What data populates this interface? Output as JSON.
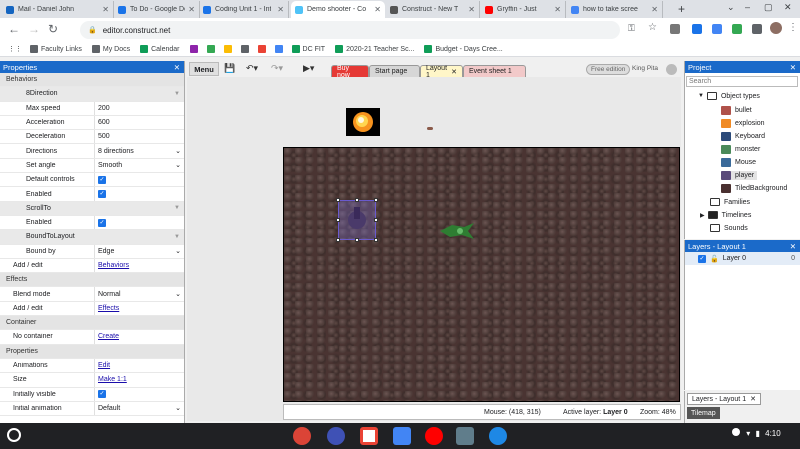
{
  "browser": {
    "tabs": [
      {
        "label": "Mail - Daniel John",
        "color": "#1565c0",
        "active": false
      },
      {
        "label": "To Do - Google Do",
        "color": "#1a73e8",
        "active": false
      },
      {
        "label": "Coding Unit 1 - Int",
        "color": "#1a73e8",
        "active": false
      },
      {
        "label": "Demo shooter - Co",
        "color": "#4fc3f7",
        "active": true
      },
      {
        "label": "Construct - New T",
        "color": "#555555",
        "active": false
      },
      {
        "label": "Gryffin - Just",
        "color": "#ff0000",
        "active": false
      },
      {
        "label": "how to take scree",
        "color": "#4285f4",
        "active": false
      }
    ],
    "new_tab": "+",
    "url": "editor.construct.net",
    "bookmarks": [
      {
        "label": "Faculty Links",
        "color": "#5f6368"
      },
      {
        "label": "My Docs",
        "color": "#5f6368"
      },
      {
        "label": "Calendar",
        "color": "#0f9d58"
      },
      {
        "label": "DC FIT",
        "color": "#0f9d58"
      },
      {
        "label": "2020-21 Teacher Sc...",
        "color": "#0f9d58"
      },
      {
        "label": "Budget - Days Cree...",
        "color": "#0f9d58"
      }
    ]
  },
  "properties": {
    "title": "Properties",
    "close": "✕",
    "rows": [
      {
        "type": "cat",
        "label": "Behaviors"
      },
      {
        "type": "sub",
        "label": "8Direction"
      },
      {
        "type": "prop",
        "label": "Max speed",
        "value": "200"
      },
      {
        "type": "prop",
        "label": "Acceleration",
        "value": "600"
      },
      {
        "type": "prop",
        "label": "Deceleration",
        "value": "500"
      },
      {
        "type": "select",
        "label": "Directions",
        "value": "8 directions"
      },
      {
        "type": "select",
        "label": "Set angle",
        "value": "Smooth"
      },
      {
        "type": "check",
        "label": "Default controls"
      },
      {
        "type": "check",
        "label": "Enabled"
      },
      {
        "type": "sub",
        "label": "ScrollTo"
      },
      {
        "type": "check",
        "label": "Enabled"
      },
      {
        "type": "sub",
        "label": "BoundToLayout"
      },
      {
        "type": "select",
        "label": "Bound by",
        "value": "Edge"
      },
      {
        "type": "link0",
        "label": "Add / edit",
        "value": "Behaviors"
      },
      {
        "type": "cat",
        "label": "Effects"
      },
      {
        "type": "select0",
        "label": "Blend mode",
        "value": "Normal"
      },
      {
        "type": "link0",
        "label": "Add / edit",
        "value": "Effects"
      },
      {
        "type": "cat",
        "label": "Container"
      },
      {
        "type": "link0",
        "label": "No container",
        "value": "Create"
      },
      {
        "type": "cat",
        "label": "Properties"
      },
      {
        "type": "link0",
        "label": "Animations",
        "value": "Edit"
      },
      {
        "type": "link0",
        "label": "Size",
        "value": "Make 1:1"
      },
      {
        "type": "check0",
        "label": "Initially visible"
      },
      {
        "type": "select0",
        "label": "Initial animation",
        "value": "Default"
      }
    ]
  },
  "toolbar": {
    "menu": "Menu",
    "tabs": [
      {
        "label": "Buy now",
        "bg": "#e53935",
        "fg": "#ffffff"
      },
      {
        "label": "Start page",
        "bg": "#d6d6d6",
        "fg": "#222222"
      },
      {
        "label": "Layout 1",
        "bg": "#fff6c8",
        "fg": "#222222"
      },
      {
        "label": "Event sheet 1",
        "bg": "#f2c9c9",
        "fg": "#222222"
      }
    ],
    "tab_close": "✕",
    "free_edition": "Free edition",
    "user": "King Pita"
  },
  "status": {
    "mouse": "Mouse: (418, 315)",
    "active_layer_label": "Active layer:",
    "active_layer": "Layer 0",
    "zoom": "Zoom: 48%"
  },
  "project": {
    "title": "Project",
    "close": "✕",
    "search_placeholder": "Search",
    "object_types_label": "Object types",
    "objects": [
      {
        "label": "bullet",
        "color": "#b0524a"
      },
      {
        "label": "explosion",
        "color": "#f08a24"
      },
      {
        "label": "Keyboard",
        "color": "#2b4a7a"
      },
      {
        "label": "monster",
        "color": "#4a8a5a"
      },
      {
        "label": "Mouse",
        "color": "#3a6a9a"
      },
      {
        "label": "player",
        "color": "#5a4a7a"
      },
      {
        "label": "TiledBackground",
        "color": "#4a3030"
      }
    ],
    "families": "Families",
    "timelines": "Timelines",
    "sounds": "Sounds"
  },
  "layers": {
    "title": "Layers - Layout 1",
    "close": "✕",
    "layer_name": "Layer 0",
    "layer_index": "0",
    "bottom_tab": "Layers - Layout 1",
    "tilemap_tab": "Tilemap"
  },
  "shelf": {
    "time": "4:10",
    "apps": [
      {
        "name": "chrome",
        "color": "#db4437"
      },
      {
        "name": "k-app",
        "color": "#3f51b5"
      },
      {
        "name": "gmail",
        "color": "#ffffff"
      },
      {
        "name": "docs",
        "color": "#4285f4"
      },
      {
        "name": "youtube",
        "color": "#ff0000"
      },
      {
        "name": "calculator",
        "color": "#607d8b"
      },
      {
        "name": "files",
        "color": "#1e88e5"
      }
    ]
  }
}
